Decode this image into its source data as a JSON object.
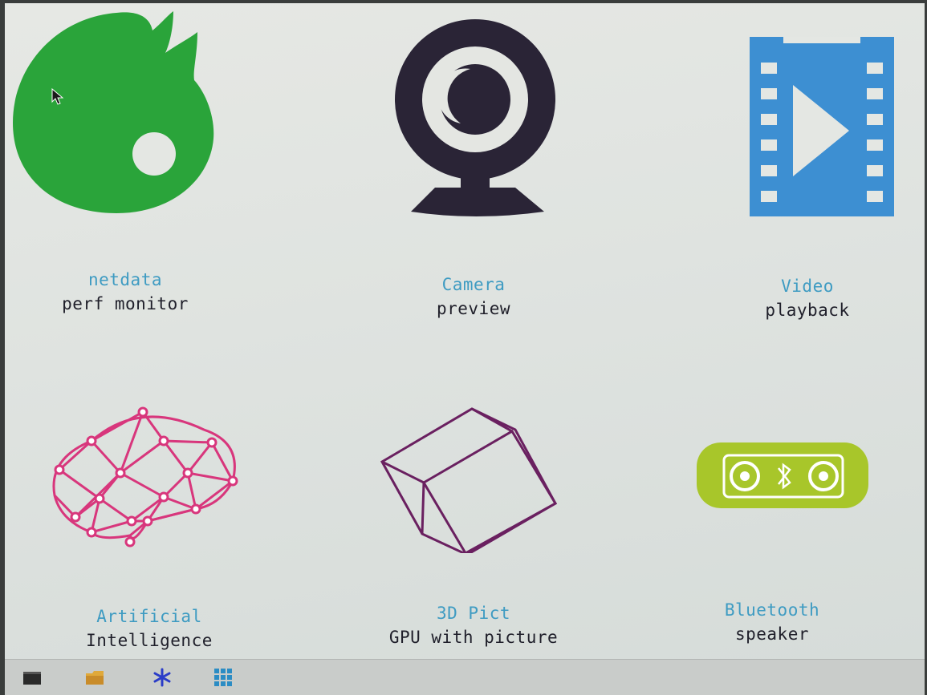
{
  "apps": [
    {
      "title": "netdata",
      "subtitle": "perf monitor",
      "icon": "netdata-icon",
      "color": "#2aa43a"
    },
    {
      "title": "Camera",
      "subtitle": "preview",
      "icon": "webcam-icon",
      "color": "#2a2436"
    },
    {
      "title": "Video",
      "subtitle": "playback",
      "icon": "film-play-icon",
      "color": "#3d8fd2"
    },
    {
      "title": "Artificial",
      "subtitle": "Intelligence",
      "icon": "brain-network-icon",
      "color": "#d8367c"
    },
    {
      "title": "3D Pict",
      "subtitle": "GPU with picture",
      "icon": "cube-icon",
      "color": "#6a2060"
    },
    {
      "title": "Bluetooth",
      "subtitle": "speaker",
      "icon": "bluetooth-speaker-icon",
      "color": "#a8c62a"
    }
  ],
  "taskbar": {
    "items": [
      "terminal-icon",
      "file-manager-icon",
      "settings-asterisk-icon",
      "app-grid-icon"
    ]
  }
}
